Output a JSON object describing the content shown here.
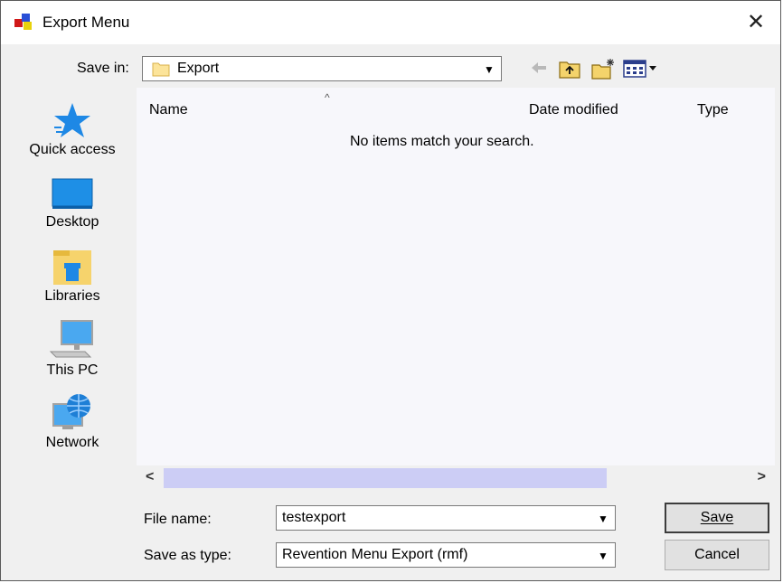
{
  "window": {
    "title": "Export Menu"
  },
  "toolbar": {
    "save_in_label": "Save in:",
    "save_in_value": "Export"
  },
  "places": [
    {
      "label": "Quick access",
      "icon": "quick-access-star-icon"
    },
    {
      "label": "Desktop",
      "icon": "desktop-icon"
    },
    {
      "label": "Libraries",
      "icon": "libraries-icon"
    },
    {
      "label": "This PC",
      "icon": "this-pc-icon"
    },
    {
      "label": "Network",
      "icon": "network-icon"
    }
  ],
  "file_list": {
    "columns": [
      "Name",
      "Date modified",
      "Type"
    ],
    "empty_message": "No items match your search."
  },
  "form": {
    "file_name_label": "File name:",
    "file_name_value": "testexport",
    "save_as_type_label": "Save as type:",
    "save_as_type_value": "Revention Menu Export (rmf)"
  },
  "buttons": {
    "save": "Save",
    "cancel": "Cancel"
  },
  "colors": {
    "dialog_bg": "#f0f0f0",
    "list_bg": "#f7f7fb",
    "scroll_thumb": "#cccdf5",
    "accent_blue": "#1e90ff"
  }
}
